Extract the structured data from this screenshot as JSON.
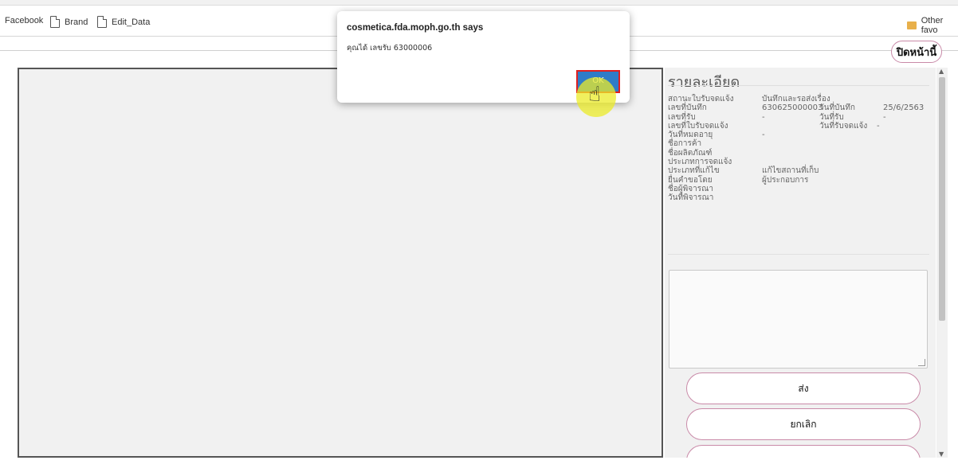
{
  "bookmarks": {
    "items": [
      {
        "label": "Facebook"
      },
      {
        "label": "Brand"
      },
      {
        "label": "Edit_Data"
      }
    ],
    "other_label": "Other favo"
  },
  "header": {
    "close_page_label": "ปิดหน้านี้"
  },
  "panel": {
    "title": "รายละเอียด",
    "rows": [
      {
        "label": "สถานะใบรับจดแจ้ง",
        "value": "บันทึกและรอส่งเรื่อง",
        "label2": "",
        "value2": ""
      },
      {
        "label": "เลขที่บันทึก",
        "value": "630625000003",
        "label2": "วันที่บันทึก",
        "value2": "25/6/2563"
      },
      {
        "label": "เลขที่รับ",
        "value": "-",
        "label2": "วันที่รับ",
        "value2": "-"
      },
      {
        "label": "เลขที่ใบรับจดแจ้ง",
        "value": "",
        "label2": "วันที่รับจดแจ้ง",
        "value2": "-"
      },
      {
        "label": "วันที่หมดอายุ",
        "value": "-",
        "label2": "",
        "value2": ""
      },
      {
        "label": "ชื่อการค้า",
        "value": "",
        "label2": "",
        "value2": ""
      },
      {
        "label": "ชื่อผลิตภัณฑ์",
        "value": "",
        "label2": "",
        "value2": ""
      },
      {
        "label": "ประเภทการจดแจ้ง",
        "value": "",
        "label2": "",
        "value2": ""
      },
      {
        "label": "ประเภทที่แก้ไข",
        "value": "แก้ไขสถานที่เก็บ",
        "label2": "",
        "value2": ""
      },
      {
        "label": "ยื่นคำขอโดย",
        "value": "ผู้ประกอบการ",
        "label2": "",
        "value2": ""
      },
      {
        "label": "ชื่อผู้พิจารณา",
        "value": "",
        "label2": "",
        "value2": ""
      },
      {
        "label": "วันที่พิจารณา",
        "value": "",
        "label2": "",
        "value2": ""
      }
    ],
    "send_label": "ส่ง",
    "cancel_label": "ยกเลิก"
  },
  "dialog": {
    "title": "cosmetica.fda.moph.go.th says",
    "message": "คุณได้ เลขรับ 63000006",
    "ok_label": "OK"
  },
  "colors": {
    "ok_button": "#2f7cc7",
    "ok_highlight_border": "#e02020",
    "pill_border": "#c98aa8",
    "cursor_halo": "#ebeb28"
  }
}
